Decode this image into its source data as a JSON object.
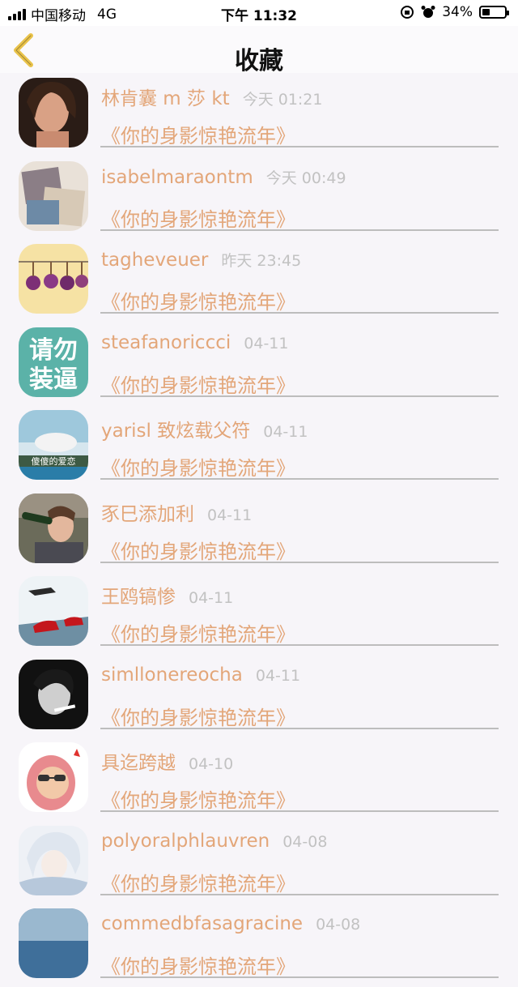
{
  "status_bar": {
    "carrier": "中国移动",
    "network": "4G",
    "time": "下午 11:32",
    "battery_percent": "34%",
    "battery_level": 0.34
  },
  "nav": {
    "title": "收藏",
    "back_icon": "chevron-left-icon",
    "accent_color": "#e9c34a"
  },
  "items": [
    {
      "username": "林肯囊 m 莎 kt",
      "time": "今天 01:21",
      "title": "《你的身影惊艳流年》",
      "avatar": "portrait"
    },
    {
      "username": "isabelmaraontm",
      "time": "今天 00:49",
      "title": "《你的身影惊艳流年》",
      "avatar": "collage"
    },
    {
      "username": "tagheveuer",
      "time": "昨天 23:45",
      "title": "《你的身影惊艳流年》",
      "avatar": "flowers"
    },
    {
      "username": "steafanoriccci",
      "time": "04-11",
      "title": "《你的身影惊艳流年》",
      "avatar": "text",
      "avatar_text": [
        "请勿",
        "装逼"
      ]
    },
    {
      "username": "yarisl 致炫载父符",
      "time": "04-11",
      "title": "《你的身影惊艳流年》",
      "avatar": "caption",
      "avatar_text": [
        "傻傻的爱恋"
      ]
    },
    {
      "username": "豕巳添加利",
      "time": "04-11",
      "title": "《你的身影惊艳流年》",
      "avatar": "drinking"
    },
    {
      "username": "王鸥镐惨",
      "time": "04-11",
      "title": "《你的身影惊艳流年》",
      "avatar": "racecar"
    },
    {
      "username": "simllonereocha",
      "time": "04-11",
      "title": "《你的身影惊艳流年》",
      "avatar": "bw"
    },
    {
      "username": "具迄跨越",
      "time": "04-10",
      "title": "《你的身影惊艳流年》",
      "avatar": "cartoon"
    },
    {
      "username": "polyoralphlauvren",
      "time": "04-08",
      "title": "《你的身影惊艳流年》",
      "avatar": "anime"
    },
    {
      "username": "commedbfasagracine",
      "time": "04-08",
      "title": "《你的身影惊艳流年》",
      "avatar": "blue"
    }
  ]
}
